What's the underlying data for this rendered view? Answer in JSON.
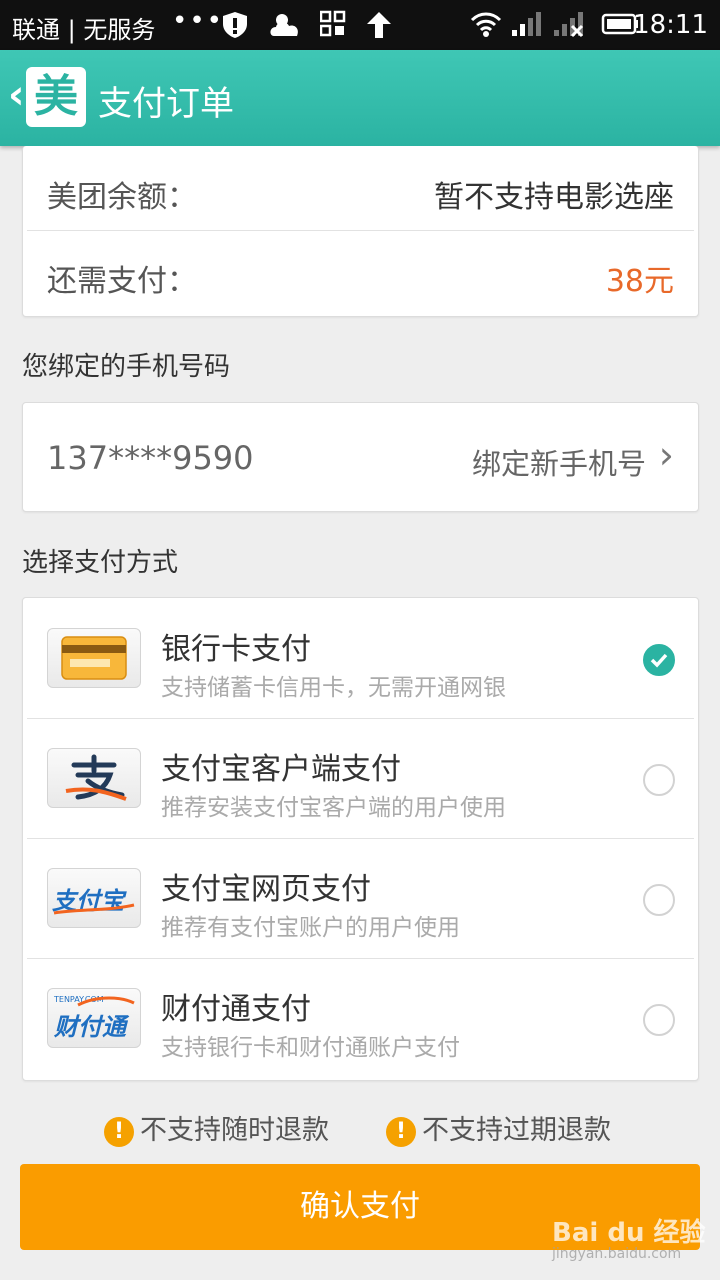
{
  "status_bar": {
    "carrier": "联通 | 无服务",
    "dots": "•••",
    "time": "18:11"
  },
  "header": {
    "back_glyph": "‹",
    "logo_text": "美",
    "title": "支付订单"
  },
  "summary": {
    "balance_label": "美团余额：",
    "balance_value": "暂不支持电影选座",
    "due_label": "还需支付：",
    "due_value": "38元",
    "due_color": "#e8692a"
  },
  "phone": {
    "section_title": "您绑定的手机号码",
    "number": "137****9590",
    "bind_new_label": "绑定新手机号",
    "chevron": "›"
  },
  "payment": {
    "section_title": "选择支付方式",
    "methods": [
      {
        "title": "银行卡支付",
        "desc": "支持储蓄卡信用卡，无需开通网银",
        "icon": "bank-card-icon",
        "selected": true
      },
      {
        "title": "支付宝客户端支付",
        "desc": "推荐安装支付宝客户端的用户使用",
        "icon": "alipay-app-icon",
        "selected": false
      },
      {
        "title": "支付宝网页支付",
        "desc": "推荐有支付宝账户的用户使用",
        "icon": "alipay-web-icon",
        "selected": false
      },
      {
        "title": "财付通支付",
        "desc": "支持银行卡和财付通账户支付",
        "icon": "tenpay-icon",
        "selected": false
      }
    ],
    "alipay_logo_text": "支付宝",
    "tenpay_small": "TENPAY.COM",
    "tenpay_logo_text": "财付通"
  },
  "notices": {
    "warn_glyph": "!",
    "no_anytime_refund": "不支持随时退款",
    "no_expired_refund": "不支持过期退款"
  },
  "confirm_label": "确认支付",
  "watermark": {
    "main": "Bai du 经验",
    "sub": "jingyan.baidu.com"
  },
  "colors": {
    "theme": "#2bb3a2",
    "confirm": "#fa9c00"
  }
}
